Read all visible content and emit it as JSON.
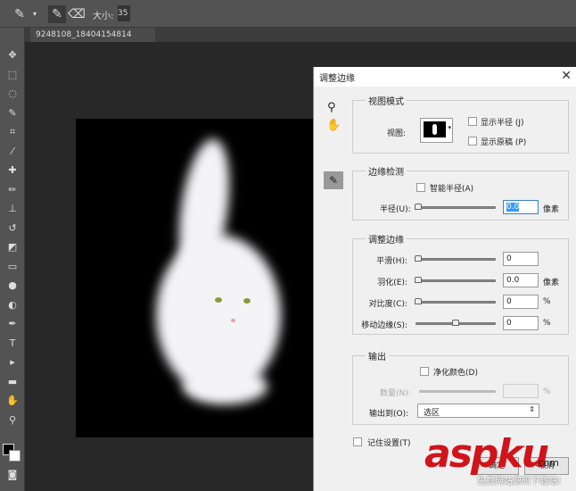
{
  "toolbar": {
    "size_label": "大小:",
    "size_value": "35"
  },
  "document_tab": {
    "name": "9248108_18404154814"
  },
  "dialog": {
    "title": "调整边缘",
    "close_icon": "close-icon",
    "view_mode": {
      "title": "视图模式",
      "view_label": "视图:",
      "show_radius": "显示半径 (J)",
      "show_original": "显示原稿 (P)"
    },
    "edge_detection": {
      "title": "边缘检测",
      "smart_radius": "智能半径(A)",
      "radius_label": "半径(U):",
      "radius_value": "0.0",
      "radius_unit": "像素"
    },
    "adjust_edge": {
      "title": "调整边缘",
      "rows": [
        {
          "label": "平滑(H):",
          "value": "0",
          "unit": "",
          "slider": 0
        },
        {
          "label": "羽化(E):",
          "value": "0.0",
          "unit": "像素",
          "slider": 0
        },
        {
          "label": "对比度(C):",
          "value": "0",
          "unit": "%",
          "slider": 0
        },
        {
          "label": "移动边缘(S):",
          "value": "0",
          "unit": "%",
          "slider": 0.5
        }
      ]
    },
    "output": {
      "title": "输出",
      "decontaminate": "净化颜色(D)",
      "amount_label": "数量(N):",
      "amount_unit": "%",
      "output_to_label": "输出到(O):",
      "output_to_value": "选区"
    },
    "remember": "记住设置(T)",
    "ok": "确定",
    "cancel": "取消"
  },
  "watermark": {
    "text": "aspku",
    ".com": ".com",
    "sub": "免费网站源码下载站!"
  }
}
